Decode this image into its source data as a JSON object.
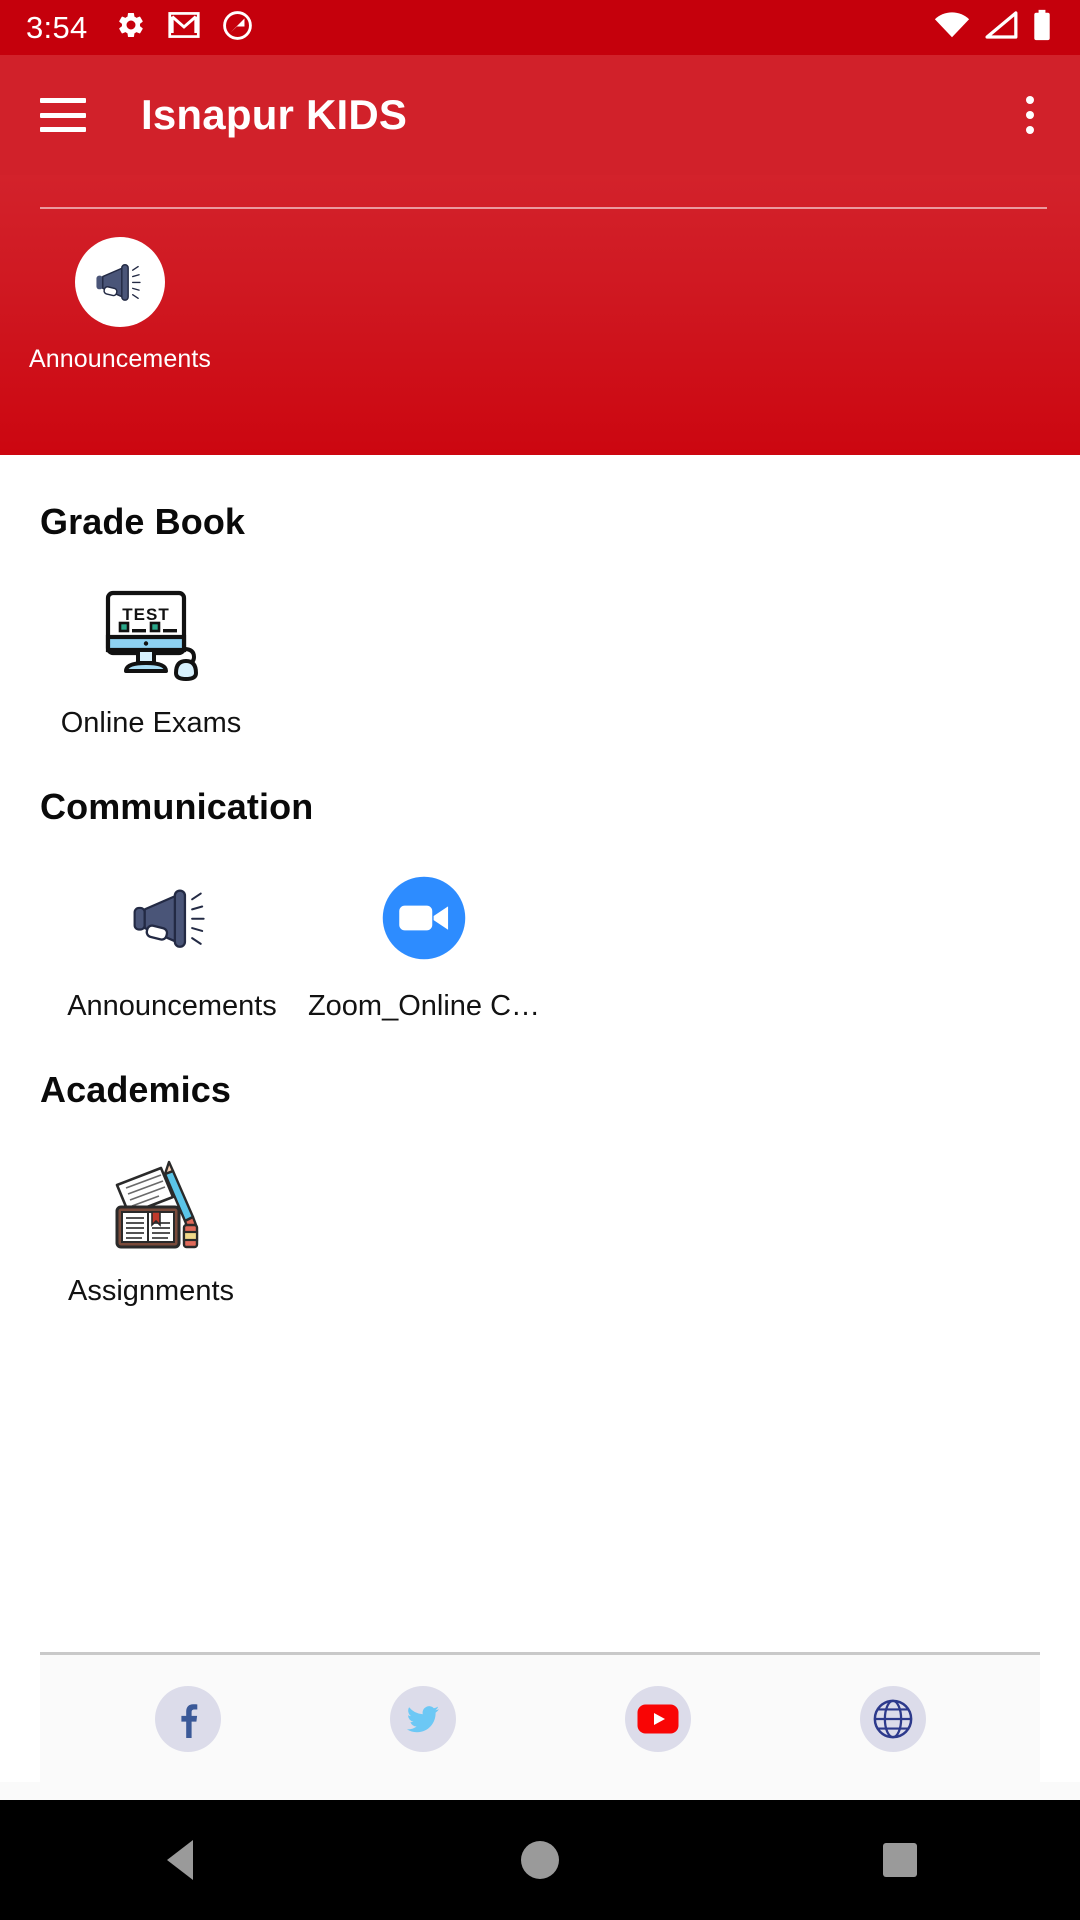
{
  "status_bar": {
    "clock": "3:54",
    "left_icons": [
      "settings-gear-icon",
      "gmail-icon",
      "do-not-disturb-icon"
    ],
    "right_icons": [
      "wifi-icon",
      "cellular-signal-icon",
      "battery-full-icon"
    ]
  },
  "app_bar": {
    "menu_icon": "hamburger-menu-icon",
    "title": "Isnapur KIDS",
    "overflow_icon": "overflow-menu-icon"
  },
  "hero": {
    "background_color": "#cf1720",
    "tile": {
      "icon": "megaphone-icon",
      "label": "Announcements"
    }
  },
  "sections": [
    {
      "title": "Grade Book",
      "tiles": [
        {
          "icon": "online-exam-monitor-icon",
          "label": "Online Exams"
        }
      ]
    },
    {
      "title": "Communication",
      "tiles": [
        {
          "icon": "megaphone-icon",
          "label": "Announcements"
        },
        {
          "icon": "zoom-video-icon",
          "label": "Zoom_Online C…"
        }
      ]
    },
    {
      "title": "Academics",
      "tiles": [
        {
          "icon": "assignments-book-pencil-icon",
          "label": "Assignments"
        }
      ]
    }
  ],
  "footer": {
    "social_links": [
      {
        "icon": "facebook-icon",
        "name": "Facebook",
        "color": "#3b5998"
      },
      {
        "icon": "twitter-icon",
        "name": "Twitter",
        "color": "#6cc8f5"
      },
      {
        "icon": "youtube-icon",
        "name": "YouTube",
        "color": "#f90505"
      },
      {
        "icon": "website-globe-icon",
        "name": "Website",
        "color": "#2d3a8c"
      }
    ]
  },
  "nav_bar": {
    "buttons": [
      {
        "icon": "back-triangle-icon",
        "label": "Back"
      },
      {
        "icon": "home-circle-icon",
        "label": "Home"
      },
      {
        "icon": "recents-square-icon",
        "label": "Recents"
      }
    ]
  },
  "theme": {
    "status_bar_color": "#c5000c",
    "app_bar_color": "#d1212a",
    "accent_color": "#cf1720",
    "text_color": "#121212"
  }
}
